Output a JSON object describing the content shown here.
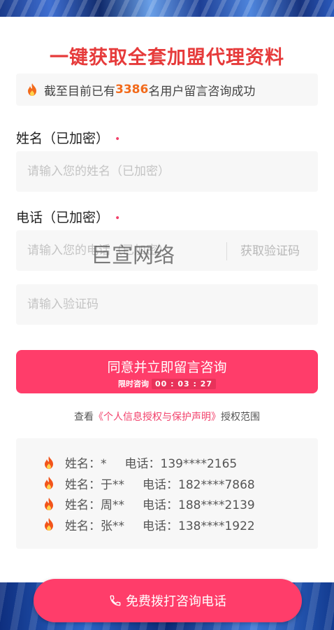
{
  "header": {
    "title": "一键获取全套加盟代理资料"
  },
  "stats": {
    "prefix": "截至目前已有",
    "count": "3386",
    "suffix": "名用户留言咨询成功",
    "icon": "fire-icon"
  },
  "form": {
    "name_label": "姓名（已加密）",
    "name_required_mark": "•",
    "name_placeholder": "请输入您的姓名（已加密）",
    "phone_label": "电话（已加密）",
    "phone_required_mark": "•",
    "phone_placeholder": "请输入您的电话（已加密）",
    "get_code_label": "获取验证码",
    "code_placeholder": "请输入验证码",
    "watermark": "巨宣网络"
  },
  "submit": {
    "label": "同意并立即留言咨询",
    "sub_label": "限时咨询",
    "timer": "00 : 03 : 27"
  },
  "privacy": {
    "prefix": "查看",
    "link": "《个人信息授权与保护声明》",
    "suffix": "授权范围"
  },
  "records": [
    {
      "name": "姓名：*",
      "phone": "电话：139****2165"
    },
    {
      "name": "姓名：于**",
      "phone": "电话：182****7868"
    },
    {
      "name": "姓名：周**",
      "phone": "电话：188****2139"
    },
    {
      "name": "姓名：张**",
      "phone": "电话：138****1922"
    }
  ],
  "call": {
    "label": "免费拨打咨询电话",
    "icon": "phone-icon"
  },
  "colors": {
    "accent": "#ff3d6a",
    "title": "#e63b3b",
    "count": "#f26a1b"
  }
}
